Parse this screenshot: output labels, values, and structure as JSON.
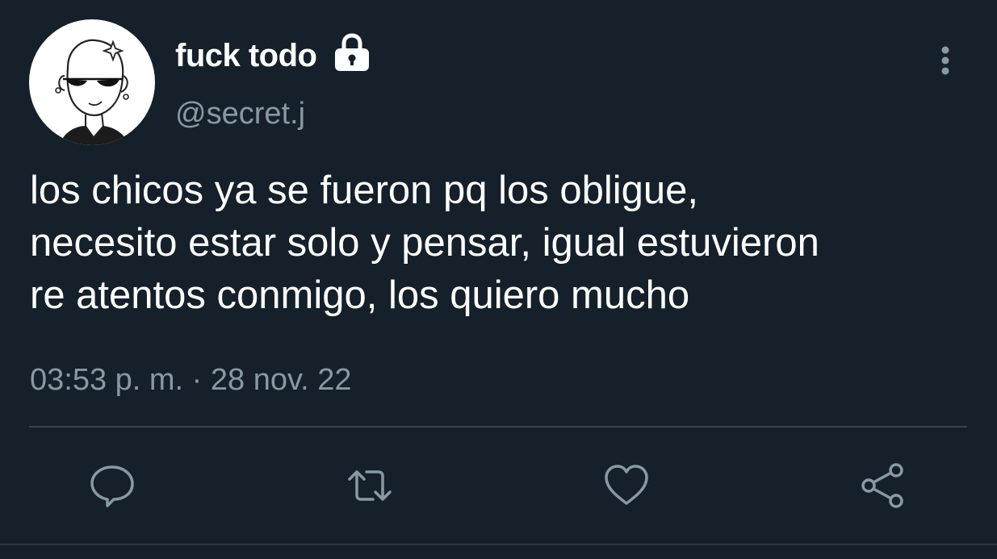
{
  "tweet": {
    "display_name": "fuck todo",
    "handle": "@secret.j",
    "protected_icon": "lock-icon",
    "text": "los chicos ya se fueron pq los obligue,\nnecesito estar solo y pensar, igual estuvieron\nre atentos conmigo, los quiero mucho",
    "timestamp": "03:53 p. m. · 28 nov. 22"
  },
  "actions": [
    {
      "name": "reply",
      "icon": "speech-bubble-icon"
    },
    {
      "name": "retweet",
      "icon": "retweet-arrows-icon"
    },
    {
      "name": "like",
      "icon": "heart-icon"
    },
    {
      "name": "share",
      "icon": "share-icon"
    }
  ],
  "colors": {
    "background": "#15202b",
    "primary_text": "#ffffff",
    "secondary_text": "#8899a6",
    "divider": "#38444d"
  }
}
